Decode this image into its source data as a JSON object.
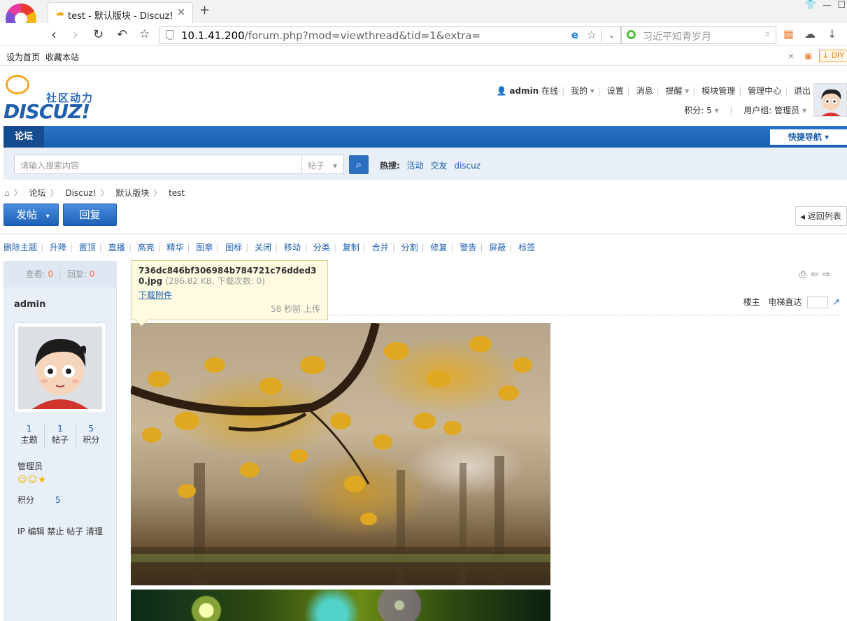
{
  "browser": {
    "tab_title": "test - 默认版块 - Discuz!",
    "url_host": "10.1.41.200",
    "url_path": "/forum.php?mod=viewthread&tid=1&extra=",
    "search_placeholder": "习近平知青岁月",
    "bookmarks": [
      "设为首页",
      "收藏本站"
    ],
    "diy_label": "DIY"
  },
  "logo": {
    "cn": "社区动力",
    "en": "DISCUZ!"
  },
  "user": {
    "name": "admin",
    "status": "在线",
    "menu": [
      "我的",
      "设置",
      "消息",
      "提醒",
      "模块管理",
      "管理中心",
      "退出"
    ],
    "points_label": "积分: 5",
    "group_label": "用户组: 管理员"
  },
  "nav": {
    "forum": "论坛",
    "quicknav": "快捷导航"
  },
  "search": {
    "placeholder": "请输入搜索内容",
    "type": "帖子",
    "hot_label": "热搜:",
    "hot_items": [
      "活动",
      "交友",
      "discuz"
    ]
  },
  "breadcrumb": [
    "论坛",
    "Discuz!",
    "默认版块",
    "test"
  ],
  "actions": {
    "post": "发帖",
    "reply": "回复",
    "back": "返回列表"
  },
  "mod_tools": [
    "删除主题",
    "升降",
    "置顶",
    "直播",
    "高亮",
    "精华",
    "图章",
    "图标",
    "关闭",
    "移动",
    "分类",
    "复制",
    "合并",
    "分割",
    "修复",
    "警告",
    "屏蔽",
    "标签"
  ],
  "thread_stats": {
    "views_label": "查看:",
    "views": "0",
    "replies_label": "回复:",
    "replies": "0"
  },
  "author": {
    "name": "admin",
    "stats": [
      {
        "value": "1",
        "label": "主题"
      },
      {
        "value": "1",
        "label": "帖子"
      },
      {
        "value": "5",
        "label": "积分"
      }
    ],
    "role": "管理员",
    "score_label": "积分",
    "score": "5",
    "admin_links": "IP 编辑 禁止 帖子 清理"
  },
  "post": {
    "floor_label": "楼主",
    "jump_label": "电梯直达"
  },
  "attachment": {
    "filename": "736dc846bf306984b784721c76dded30.jpg",
    "meta": "(286.82 KB, 下载次数: 0)",
    "download": "下载附件",
    "uploaded": "58 秒前 上传"
  }
}
